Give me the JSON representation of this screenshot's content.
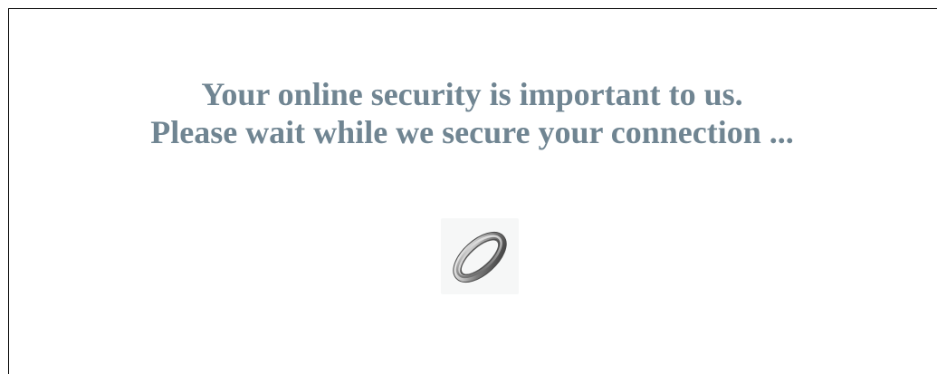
{
  "message": {
    "line1": "Your online security is important to us.",
    "line2": "Please wait while we secure your connection ..."
  },
  "spinner": {
    "icon": "loading-ring-icon"
  },
  "colors": {
    "text": "#708592",
    "background": "#ffffff",
    "border": "#000000"
  }
}
